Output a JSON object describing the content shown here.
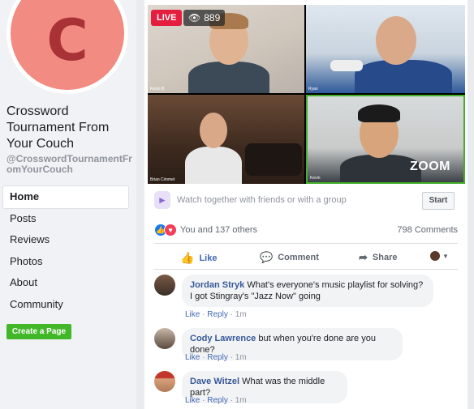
{
  "sidebar": {
    "avatar_letter": "C",
    "page_name": "Crossword Tournament From Your Couch",
    "handle": "@CrosswordTournamentFromYourCouch",
    "nav": [
      {
        "label": "Home",
        "active": true
      },
      {
        "label": "Posts"
      },
      {
        "label": "Reviews"
      },
      {
        "label": "Photos"
      },
      {
        "label": "About"
      },
      {
        "label": "Community"
      }
    ],
    "create_page": "Create a Page"
  },
  "video": {
    "live_label": "LIVE",
    "viewers": "889",
    "zoom_logo": "ZOOM",
    "tile_names": [
      "Kevin B",
      "Ryan",
      "Brian Cimmet",
      "Kevin"
    ]
  },
  "watch_party": {
    "text": "Watch together with friends or with a group",
    "start": "Start"
  },
  "reactions": {
    "text": "You and 137 others",
    "comments": "798 Comments"
  },
  "actions": {
    "like": "Like",
    "comment": "Comment",
    "share": "Share"
  },
  "comments": [
    {
      "author": "Jordan Stryk",
      "text": "What's everyone's music playlist for solving? I got Stingray's \"Jazz Now\" going",
      "like": "Like",
      "reply": "Reply",
      "time": "1m"
    },
    {
      "author": "Cody Lawrence",
      "text": "but when you're done are you done?",
      "like": "Like",
      "reply": "Reply",
      "time": "1m"
    },
    {
      "author": "Dave Witzel",
      "text": "What was the middle part?",
      "like": "Like",
      "reply": "Reply",
      "time": "1m"
    }
  ],
  "colors": {
    "live": "#e41e3f",
    "link": "#385898",
    "create_button": "#42b72a",
    "avatar_bg": "#f28b82"
  }
}
